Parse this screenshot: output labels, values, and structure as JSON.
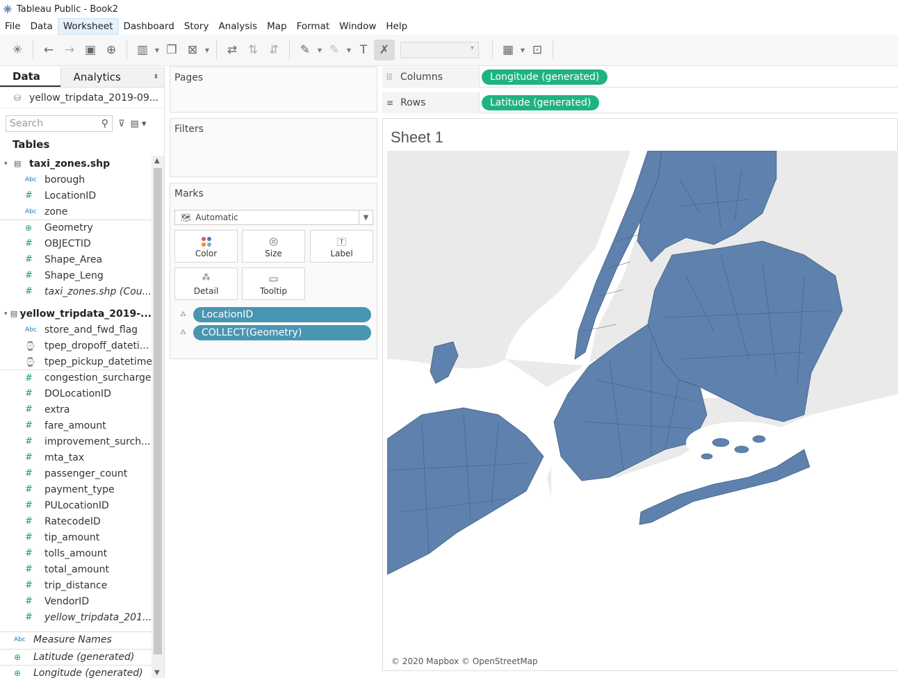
{
  "window": {
    "title": "Tableau Public - Book2"
  },
  "menu": [
    "File",
    "Data",
    "Worksheet",
    "Dashboard",
    "Story",
    "Analysis",
    "Map",
    "Format",
    "Window",
    "Help"
  ],
  "data_pane": {
    "tab_data": "Data",
    "tab_analytics": "Analytics",
    "datasource": "yellow_tripdata_2019-09...",
    "search_placeholder": "Search",
    "tables_heading": "Tables",
    "table1": {
      "name": "taxi_zones.shp",
      "fields": [
        {
          "type": "abc",
          "label": "borough"
        },
        {
          "type": "num",
          "label": "LocationID"
        },
        {
          "type": "abc",
          "label": "zone"
        },
        {
          "type": "geo",
          "label": "Geometry"
        },
        {
          "type": "num",
          "label": "OBJECTID"
        },
        {
          "type": "num",
          "label": "Shape_Area"
        },
        {
          "type": "num",
          "label": "Shape_Leng"
        },
        {
          "type": "num",
          "label": "taxi_zones.shp (Cou...",
          "italic": true
        }
      ]
    },
    "table2": {
      "name": "yellow_tripdata_2019-...",
      "fields": [
        {
          "type": "abc",
          "label": "store_and_fwd_flag"
        },
        {
          "type": "date",
          "label": "tpep_dropoff_dateti..."
        },
        {
          "type": "date",
          "label": "tpep_pickup_datetime"
        },
        {
          "type": "num",
          "label": "congestion_surcharge"
        },
        {
          "type": "num",
          "label": "DOLocationID"
        },
        {
          "type": "num",
          "label": "extra"
        },
        {
          "type": "num",
          "label": "fare_amount"
        },
        {
          "type": "num",
          "label": "improvement_surch..."
        },
        {
          "type": "num",
          "label": "mta_tax"
        },
        {
          "type": "num",
          "label": "passenger_count"
        },
        {
          "type": "num",
          "label": "payment_type"
        },
        {
          "type": "num",
          "label": "PULocationID"
        },
        {
          "type": "num",
          "label": "RatecodeID"
        },
        {
          "type": "num",
          "label": "tip_amount"
        },
        {
          "type": "num",
          "label": "tolls_amount"
        },
        {
          "type": "num",
          "label": "total_amount"
        },
        {
          "type": "num",
          "label": "trip_distance"
        },
        {
          "type": "num",
          "label": "VendorID"
        },
        {
          "type": "num",
          "label": "yellow_tripdata_201...",
          "italic": true
        }
      ]
    },
    "extra_fields": [
      {
        "type": "abc",
        "label": "Measure Names",
        "italic": true
      },
      {
        "type": "geo",
        "label": "Latitude (generated)",
        "italic": true
      },
      {
        "type": "geo",
        "label": "Longitude (generated)",
        "italic": true
      }
    ]
  },
  "cards": {
    "pages": "Pages",
    "filters": "Filters",
    "marks": "Marks",
    "mark_type": "Automatic",
    "buttons": {
      "color": "Color",
      "size": "Size",
      "label": "Label",
      "detail": "Detail",
      "tooltip": "Tooltip"
    },
    "pills": [
      "LocationID",
      "COLLECT(Geometry)"
    ]
  },
  "shelves": {
    "columns_label": "Columns",
    "columns_pill": "Longitude (generated)",
    "rows_label": "Rows",
    "rows_pill": "Latitude (generated)"
  },
  "sheet": {
    "title": "Sheet 1",
    "attribution": "© 2020 Mapbox © OpenStreetMap",
    "fill_color": "#5e82ad",
    "border_color": "#3f5f85",
    "water_color": "#ffffff",
    "land_color": "#eaeaea"
  },
  "colors": {
    "green_pill": "#1fb382",
    "blue_pill": "#4996b2"
  }
}
